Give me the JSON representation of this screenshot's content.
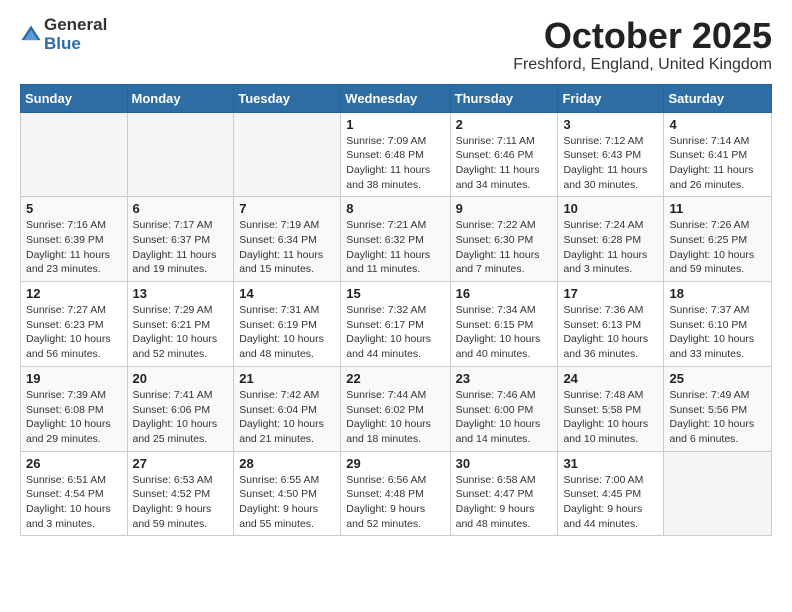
{
  "header": {
    "logo_general": "General",
    "logo_blue": "Blue",
    "month_title": "October 2025",
    "location": "Freshford, England, United Kingdom"
  },
  "weekdays": [
    "Sunday",
    "Monday",
    "Tuesday",
    "Wednesday",
    "Thursday",
    "Friday",
    "Saturday"
  ],
  "weeks": [
    [
      {
        "day": "",
        "info": ""
      },
      {
        "day": "",
        "info": ""
      },
      {
        "day": "",
        "info": ""
      },
      {
        "day": "1",
        "info": "Sunrise: 7:09 AM\nSunset: 6:48 PM\nDaylight: 11 hours\nand 38 minutes."
      },
      {
        "day": "2",
        "info": "Sunrise: 7:11 AM\nSunset: 6:46 PM\nDaylight: 11 hours\nand 34 minutes."
      },
      {
        "day": "3",
        "info": "Sunrise: 7:12 AM\nSunset: 6:43 PM\nDaylight: 11 hours\nand 30 minutes."
      },
      {
        "day": "4",
        "info": "Sunrise: 7:14 AM\nSunset: 6:41 PM\nDaylight: 11 hours\nand 26 minutes."
      }
    ],
    [
      {
        "day": "5",
        "info": "Sunrise: 7:16 AM\nSunset: 6:39 PM\nDaylight: 11 hours\nand 23 minutes."
      },
      {
        "day": "6",
        "info": "Sunrise: 7:17 AM\nSunset: 6:37 PM\nDaylight: 11 hours\nand 19 minutes."
      },
      {
        "day": "7",
        "info": "Sunrise: 7:19 AM\nSunset: 6:34 PM\nDaylight: 11 hours\nand 15 minutes."
      },
      {
        "day": "8",
        "info": "Sunrise: 7:21 AM\nSunset: 6:32 PM\nDaylight: 11 hours\nand 11 minutes."
      },
      {
        "day": "9",
        "info": "Sunrise: 7:22 AM\nSunset: 6:30 PM\nDaylight: 11 hours\nand 7 minutes."
      },
      {
        "day": "10",
        "info": "Sunrise: 7:24 AM\nSunset: 6:28 PM\nDaylight: 11 hours\nand 3 minutes."
      },
      {
        "day": "11",
        "info": "Sunrise: 7:26 AM\nSunset: 6:25 PM\nDaylight: 10 hours\nand 59 minutes."
      }
    ],
    [
      {
        "day": "12",
        "info": "Sunrise: 7:27 AM\nSunset: 6:23 PM\nDaylight: 10 hours\nand 56 minutes."
      },
      {
        "day": "13",
        "info": "Sunrise: 7:29 AM\nSunset: 6:21 PM\nDaylight: 10 hours\nand 52 minutes."
      },
      {
        "day": "14",
        "info": "Sunrise: 7:31 AM\nSunset: 6:19 PM\nDaylight: 10 hours\nand 48 minutes."
      },
      {
        "day": "15",
        "info": "Sunrise: 7:32 AM\nSunset: 6:17 PM\nDaylight: 10 hours\nand 44 minutes."
      },
      {
        "day": "16",
        "info": "Sunrise: 7:34 AM\nSunset: 6:15 PM\nDaylight: 10 hours\nand 40 minutes."
      },
      {
        "day": "17",
        "info": "Sunrise: 7:36 AM\nSunset: 6:13 PM\nDaylight: 10 hours\nand 36 minutes."
      },
      {
        "day": "18",
        "info": "Sunrise: 7:37 AM\nSunset: 6:10 PM\nDaylight: 10 hours\nand 33 minutes."
      }
    ],
    [
      {
        "day": "19",
        "info": "Sunrise: 7:39 AM\nSunset: 6:08 PM\nDaylight: 10 hours\nand 29 minutes."
      },
      {
        "day": "20",
        "info": "Sunrise: 7:41 AM\nSunset: 6:06 PM\nDaylight: 10 hours\nand 25 minutes."
      },
      {
        "day": "21",
        "info": "Sunrise: 7:42 AM\nSunset: 6:04 PM\nDaylight: 10 hours\nand 21 minutes."
      },
      {
        "day": "22",
        "info": "Sunrise: 7:44 AM\nSunset: 6:02 PM\nDaylight: 10 hours\nand 18 minutes."
      },
      {
        "day": "23",
        "info": "Sunrise: 7:46 AM\nSunset: 6:00 PM\nDaylight: 10 hours\nand 14 minutes."
      },
      {
        "day": "24",
        "info": "Sunrise: 7:48 AM\nSunset: 5:58 PM\nDaylight: 10 hours\nand 10 minutes."
      },
      {
        "day": "25",
        "info": "Sunrise: 7:49 AM\nSunset: 5:56 PM\nDaylight: 10 hours\nand 6 minutes."
      }
    ],
    [
      {
        "day": "26",
        "info": "Sunrise: 6:51 AM\nSunset: 4:54 PM\nDaylight: 10 hours\nand 3 minutes."
      },
      {
        "day": "27",
        "info": "Sunrise: 6:53 AM\nSunset: 4:52 PM\nDaylight: 9 hours\nand 59 minutes."
      },
      {
        "day": "28",
        "info": "Sunrise: 6:55 AM\nSunset: 4:50 PM\nDaylight: 9 hours\nand 55 minutes."
      },
      {
        "day": "29",
        "info": "Sunrise: 6:56 AM\nSunset: 4:48 PM\nDaylight: 9 hours\nand 52 minutes."
      },
      {
        "day": "30",
        "info": "Sunrise: 6:58 AM\nSunset: 4:47 PM\nDaylight: 9 hours\nand 48 minutes."
      },
      {
        "day": "31",
        "info": "Sunrise: 7:00 AM\nSunset: 4:45 PM\nDaylight: 9 hours\nand 44 minutes."
      },
      {
        "day": "",
        "info": ""
      }
    ]
  ]
}
